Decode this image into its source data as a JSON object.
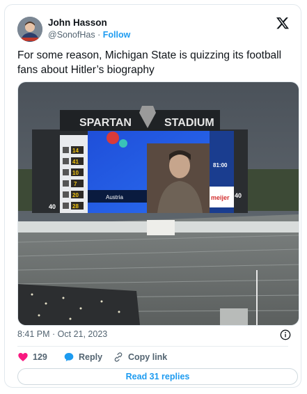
{
  "author": {
    "name": "John Hasson",
    "handle": "@SonofHas",
    "separator": "·",
    "follow_label": "Follow"
  },
  "tweet": {
    "text": "For some reason, Michigan State is quizzing its football fans about Hitler’s biography",
    "timestamp": "8:41 PM · Oct 21, 2023"
  },
  "media": {
    "stadium_name_left": "SPARTAN",
    "stadium_name_right": "STADIUM",
    "answer_label": "Austria",
    "sponsor_label": "meijer",
    "clock": "81:00",
    "side_number_left": "40",
    "side_number_right": "40",
    "score_rows": [
      "14",
      "41",
      "10",
      "7",
      "20",
      "28"
    ]
  },
  "actions": {
    "likes_count": "129",
    "reply_label": "Reply",
    "copy_link_label": "Copy link"
  },
  "read_replies_label": "Read 31 replies",
  "colors": {
    "accent": "#1d9bf0",
    "like": "#f91880",
    "text": "#0f1419",
    "secondary": "#536471"
  },
  "icons": {
    "logo": "x-logo-icon",
    "info": "info-icon",
    "like": "heart-icon",
    "reply": "reply-bubble-icon",
    "copy_link": "link-icon"
  }
}
